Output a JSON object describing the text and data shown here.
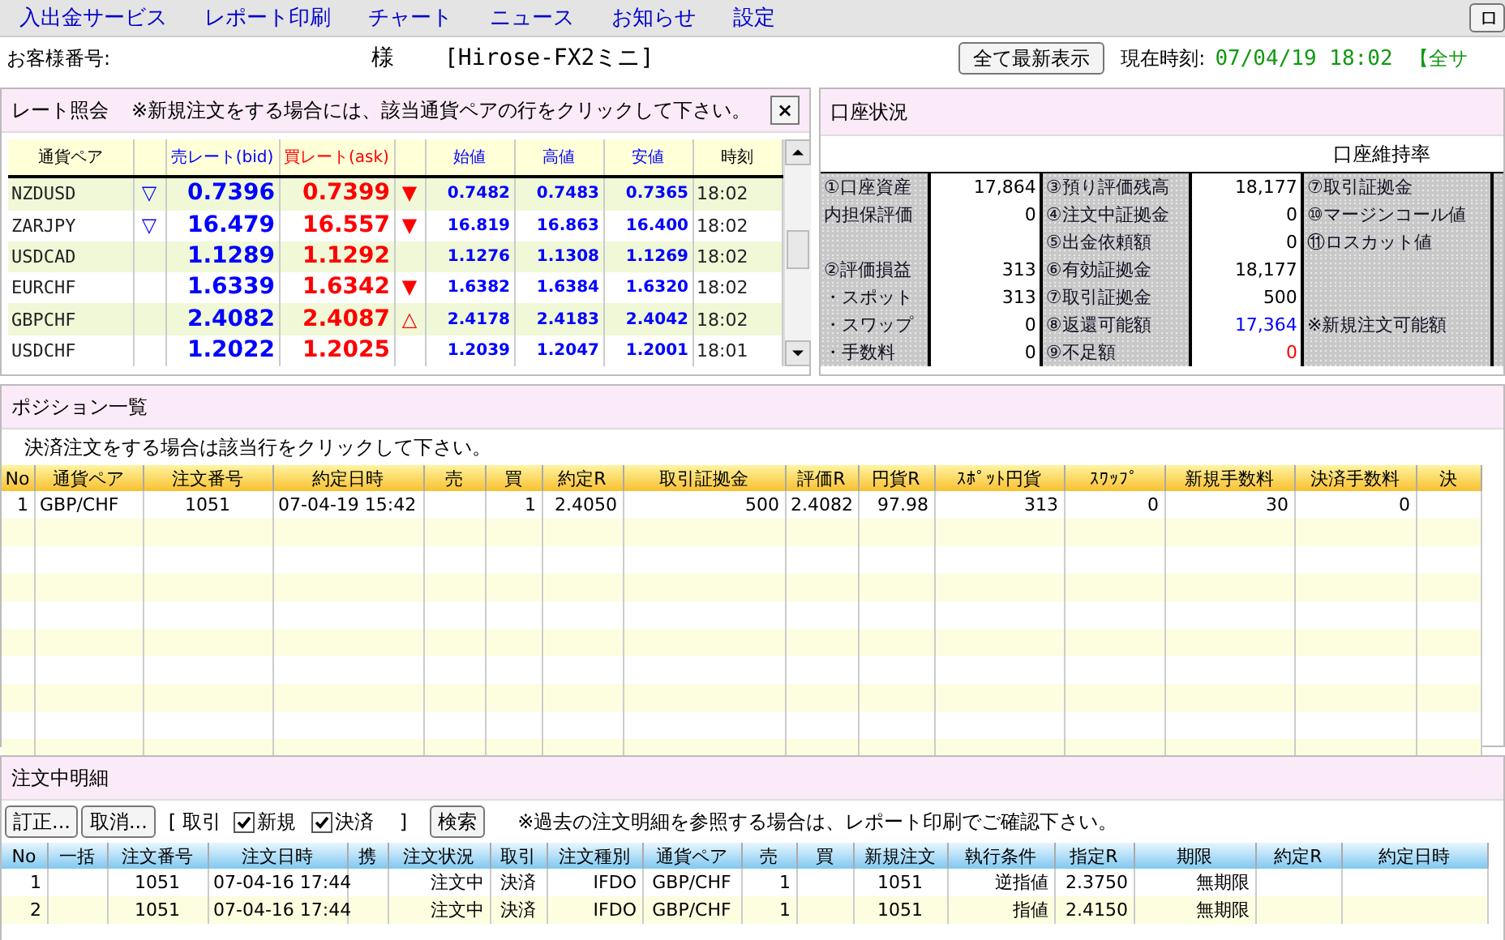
{
  "menu": {
    "items": [
      "入出金サービス",
      "レポート印刷",
      "チャート",
      "ニュース",
      "お知らせ",
      "設定"
    ],
    "cut_button": "ロ"
  },
  "info": {
    "customer_label": "お客様番号:",
    "honorific": "様",
    "product": "[Hirose-FX2ミニ]",
    "refresh_button": "全て最新表示",
    "time_label": "現在時刻:",
    "time": "07/04/19 18:02",
    "cut_label": "【全サ"
  },
  "rate_panel": {
    "title": "レート照会",
    "note": "※新規注文をする場合には、該当通貨ペアの行をクリックして下さい。",
    "close": "×",
    "columns": [
      {
        "label": "通貨ペア",
        "color": "#000000"
      },
      {},
      {
        "label": "売レート(bid)",
        "color": "#0000ff"
      },
      {
        "label": "買レート(ask)",
        "color": "#ff0000"
      },
      {},
      {
        "label": "始値",
        "color": "#0000ff"
      },
      {
        "label": "高値",
        "color": "#0000ff"
      },
      {
        "label": "安値",
        "color": "#0000ff"
      },
      {
        "label": "時刻",
        "color": "#000000"
      }
    ],
    "rows": [
      {
        "pair": "NZDUSD",
        "bid_arrow": "▽",
        "bid": "0.7396",
        "ask": "0.7399",
        "ask_arrow": "▼",
        "open": "0.7482",
        "high": "0.7483",
        "low": "0.7365",
        "time": "18:02"
      },
      {
        "pair": "ZARJPY",
        "bid_arrow": "▽",
        "bid": "16.479",
        "ask": "16.557",
        "ask_arrow": "▼",
        "open": "16.819",
        "high": "16.863",
        "low": "16.400",
        "time": "18:02"
      },
      {
        "pair": "USDCAD",
        "bid": "1.1289",
        "ask": "1.1292",
        "open": "1.1276",
        "high": "1.1308",
        "low": "1.1269",
        "time": "18:02"
      },
      {
        "pair": "EURCHF",
        "bid": "1.6339",
        "ask": "1.6342",
        "ask_arrow": "▼",
        "open": "1.6382",
        "high": "1.6384",
        "low": "1.6320",
        "time": "18:02"
      },
      {
        "pair": "GBPCHF",
        "bid": "2.4082",
        "ask": "2.4087",
        "ask_arrow": "△",
        "open": "2.4178",
        "high": "2.4183",
        "low": "2.4042",
        "time": "18:02"
      },
      {
        "pair": "USDCHF",
        "bid": "1.2022",
        "ask": "1.2025",
        "open": "1.2039",
        "high": "1.2047",
        "low": "1.2001",
        "time": "18:01"
      }
    ]
  },
  "account": {
    "title": "口座状況",
    "ratio_label": "口座維持率",
    "rows": [
      [
        {
          "text": "①口座資産"
        },
        {
          "text": "17,864"
        },
        {
          "text": "③預り評価残高"
        },
        {
          "text": "18,177"
        },
        {
          "text": "⑦取引証拠金"
        }
      ],
      [
        {
          "text": "内担保評価"
        },
        {
          "text": "0"
        },
        {
          "text": "④注文中証拠金"
        },
        {
          "text": "0"
        },
        {
          "text": "⑩マージンコール値"
        }
      ],
      [
        null,
        null,
        {
          "text": "⑤出金依頼額"
        },
        {
          "text": "0"
        },
        {
          "text": "⑪ロスカット値"
        }
      ],
      [
        {
          "text": "②評価損益"
        },
        {
          "text": "313"
        },
        {
          "text": "⑥有効証拠金"
        },
        {
          "text": "18,177"
        },
        null
      ],
      [
        {
          "text": "・スポット"
        },
        {
          "text": "313"
        },
        {
          "text": "⑦取引証拠金"
        },
        {
          "text": "500"
        },
        null
      ],
      [
        {
          "text": "・スワップ"
        },
        {
          "text": "0"
        },
        {
          "text": "⑧返還可能額"
        },
        {
          "text": "17,364",
          "color": "#0000ff"
        },
        {
          "text": "※新規注文可能額"
        }
      ],
      [
        {
          "text": "・手数料"
        },
        {
          "text": "0"
        },
        {
          "text": "⑨不足額"
        },
        {
          "text": "0",
          "color": "#ff0000"
        },
        null
      ]
    ]
  },
  "positions": {
    "title": "ポジション一覧",
    "note": "決済注文をする場合は該当行をクリックして下さい。",
    "columns": [
      "No",
      "通貨ペア",
      "注文番号",
      "約定日時",
      "売",
      "買",
      "約定R",
      "取引証拠金",
      "評価R",
      "円貨R",
      "ｽﾎﾟｯﾄ円貨",
      "ｽﾜｯﾌﾟ",
      "新規手数料",
      "決済手数料",
      "決"
    ],
    "rows": [
      [
        "1",
        "GBP/CHF",
        "1051",
        "07-04-19 15:42",
        null,
        "1",
        "2.4050",
        "500",
        "2.4082",
        "97.98",
        "313",
        "0",
        "30",
        "0",
        null
      ]
    ]
  },
  "orders": {
    "title": "注文中明細",
    "buttons": [
      "訂正...",
      "取消..."
    ],
    "bracket_open": "[ 取引",
    "filters": [
      {
        "label": "新規",
        "checked": true
      },
      {
        "label": "決済",
        "checked": true
      }
    ],
    "bracket_close": "]",
    "search_button": "検索",
    "note": "※過去の注文明細を参照する場合は、レポート印刷でご確認下さい。",
    "columns": [
      "No",
      "一括",
      "注文番号",
      "注文日時",
      "携",
      "注文状況",
      "取引",
      "注文種別",
      "通貨ペア",
      "売",
      "買",
      "新規注文",
      "執行条件",
      "指定R",
      "期限",
      "約定R",
      "約定日時"
    ],
    "rows": [
      [
        "1",
        null,
        "1051",
        "07-04-16 17:44",
        null,
        "注文中",
        "決済",
        "IFDO",
        "GBP/CHF",
        "1",
        null,
        "1051",
        "逆指値",
        "2.3750",
        "無期限",
        null,
        null
      ],
      [
        "2",
        null,
        "1051",
        "07-04-16 17:44",
        null,
        "注文中",
        "決済",
        "IFDO",
        "GBP/CHF",
        "1",
        null,
        "1051",
        "指値",
        "2.4150",
        "無期限",
        null,
        null
      ]
    ]
  }
}
